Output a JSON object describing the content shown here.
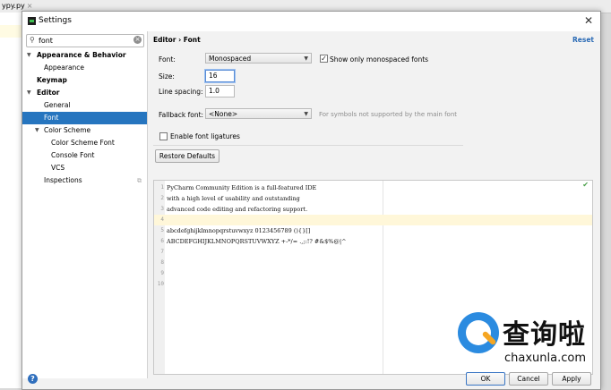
{
  "background": {
    "tab_label": "ypy.py",
    "tab_close": "×"
  },
  "window": {
    "title": "Settings",
    "close_glyph": "✕"
  },
  "search": {
    "value": "font",
    "clear_glyph": "×",
    "icon": "search-icon"
  },
  "tree": {
    "appearance_behavior": "Appearance & Behavior",
    "appearance": "Appearance",
    "keymap": "Keymap",
    "editor": "Editor",
    "general": "General",
    "font": "Font",
    "color_scheme": "Color Scheme",
    "color_scheme_font": "Color Scheme Font",
    "console_font": "Console Font",
    "vcs": "VCS",
    "inspections": "Inspections",
    "inspections_icon": "⧉"
  },
  "panel": {
    "breadcrumb": "Editor › Font",
    "reset": "Reset",
    "font_label": "Font:",
    "font_value": "Monospaced",
    "monospaced_only_label": "Show only monospaced fonts",
    "monospaced_only_checked": true,
    "size_label": "Size:",
    "size_value": "16",
    "line_spacing_label": "Line spacing:",
    "line_spacing_value": "1.0",
    "fallback_label": "Fallback font:",
    "fallback_value": "<None>",
    "fallback_hint": "For symbols not supported by the main font",
    "ligatures_label": "Enable font ligatures",
    "ligatures_checked": false,
    "restore_button": "Restore Defaults"
  },
  "preview": {
    "lines": [
      {
        "num": "1",
        "text": "PyCharm Community Edition is a full-featured IDE"
      },
      {
        "num": "2",
        "text": "with a high level of usability and outstanding"
      },
      {
        "num": "3",
        "text": "advanced code editing and refactoring support."
      },
      {
        "num": "4",
        "text": ""
      },
      {
        "num": "5",
        "text": "abcdefghijklmnopqrstuvwxyz 0123456789 (){}[]"
      },
      {
        "num": "6",
        "text": "ABCDEFGHIJKLMNOPQRSTUVWXYZ +-*/= .,;:!? #&$%@|^"
      },
      {
        "num": "7",
        "text": ""
      },
      {
        "num": "8",
        "text": ""
      },
      {
        "num": "9",
        "text": ""
      },
      {
        "num": "10",
        "text": ""
      }
    ],
    "check_glyph": "✔"
  },
  "footer": {
    "help": "?",
    "ok": "OK",
    "cancel": "Cancel",
    "apply": "Apply"
  },
  "watermark": {
    "cn": "查询啦",
    "en": "chaxunla.com"
  }
}
